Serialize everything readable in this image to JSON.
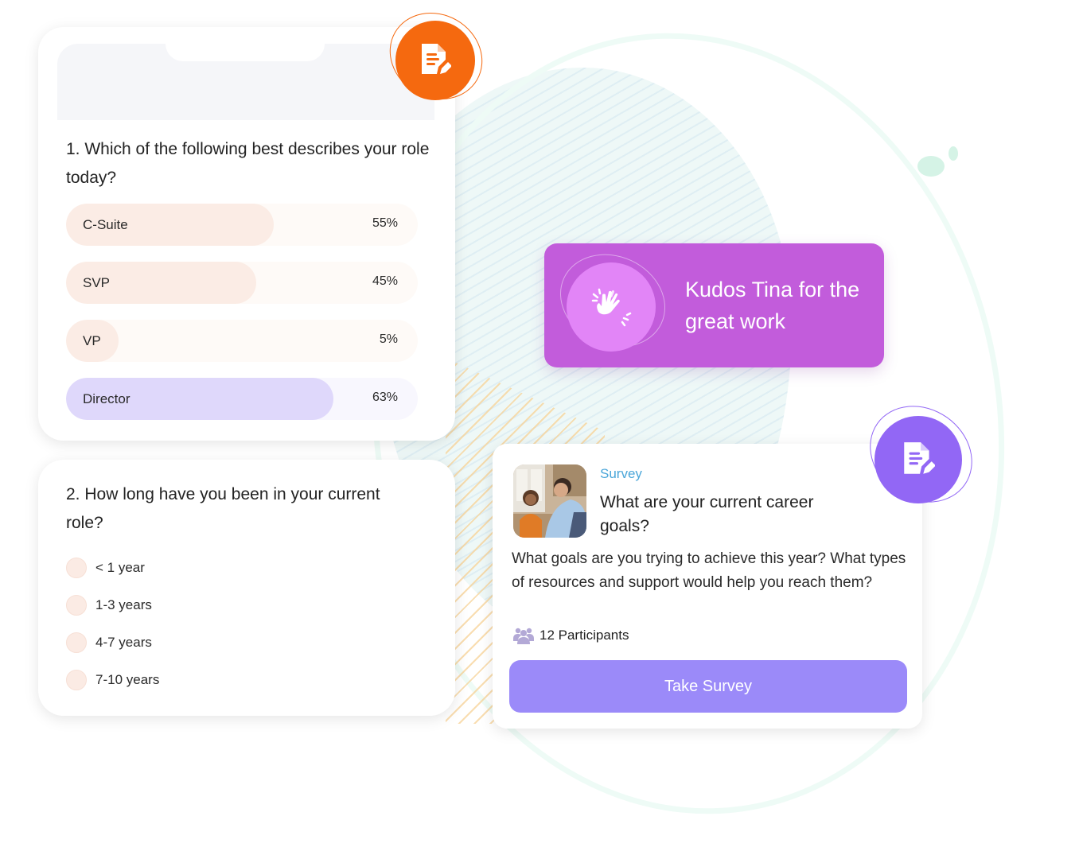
{
  "poll": {
    "question": "1. Which of the following best describes your role today?",
    "options": [
      {
        "label": "C-Suite",
        "percent_text": "55%",
        "bar_fraction": 0.59,
        "color": "#fbece5",
        "track": "#fefaf7"
      },
      {
        "label": "SVP",
        "percent_text": "45%",
        "bar_fraction": 0.54,
        "color": "#fbece5",
        "track": "#fefaf7"
      },
      {
        "label": "VP",
        "percent_text": "5%",
        "bar_fraction": 0.15,
        "color": "#fbece5",
        "track": "#fefaf7"
      },
      {
        "label": "Director",
        "percent_text": "63%",
        "bar_fraction": 0.76,
        "color": "#dfd8fb",
        "track": "#f8f7fe"
      }
    ]
  },
  "tenure": {
    "question": "2. How long have you been in your current role?",
    "options": [
      "< 1 year",
      "1-3 years",
      "4-7 years",
      "7-10 years"
    ]
  },
  "kudos": {
    "message": "Kudos Tina for the great work",
    "icon": "clapping-hands-icon"
  },
  "survey": {
    "tag": "Survey",
    "title": "What are your current career goals?",
    "description": "What goals are you trying to achieve this year? What types of resources and support would help you reach them?",
    "participants": "12 Participants",
    "button_label": "Take Survey",
    "thumbnail_alt": "Two colleagues talking in an office"
  },
  "badges": {
    "orange": {
      "icon": "document-edit-icon",
      "color": "#f5690f"
    },
    "purple": {
      "icon": "document-edit-icon",
      "color": "#9267f5"
    }
  }
}
